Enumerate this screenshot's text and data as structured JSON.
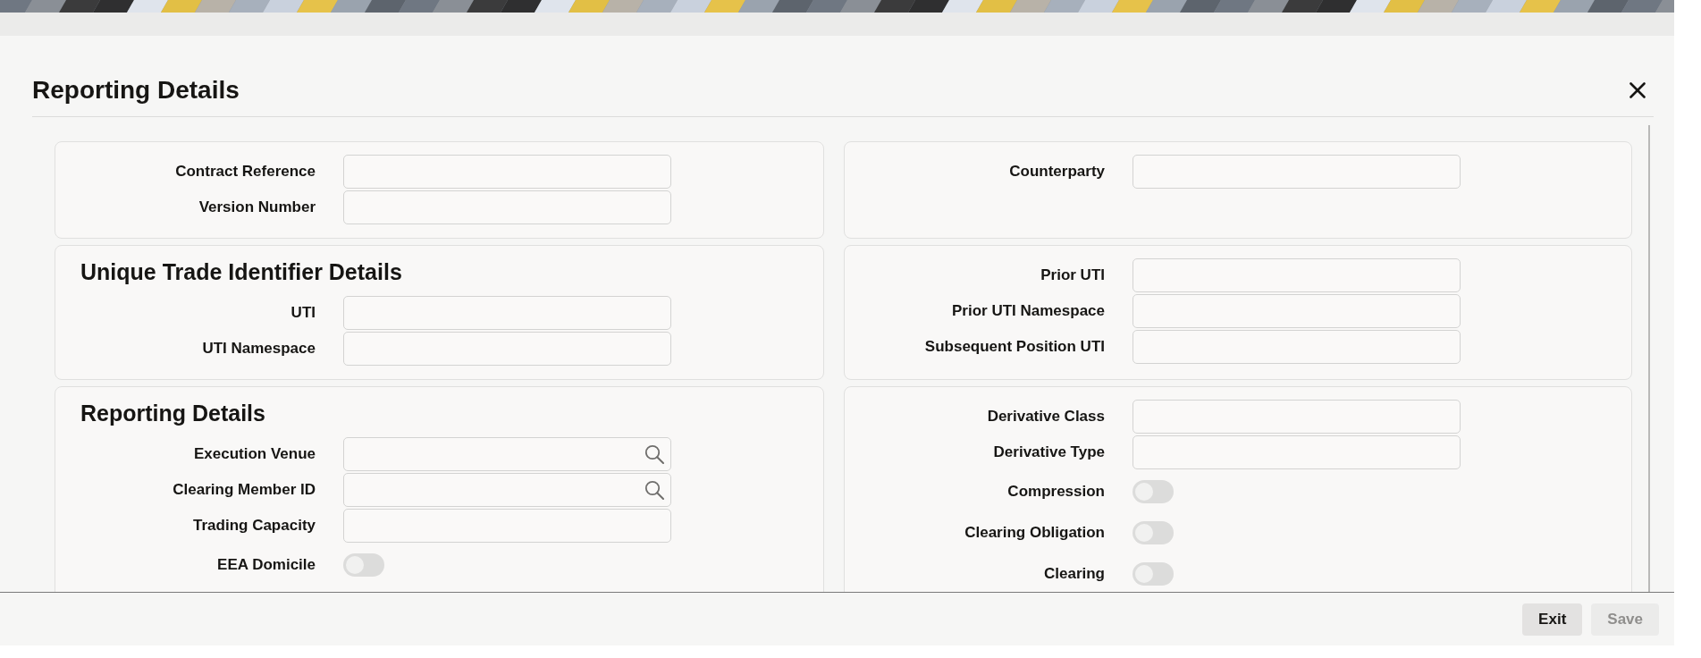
{
  "title": "Reporting Details",
  "rows": [
    {
      "left": {
        "fields": [
          {
            "kind": "text",
            "label": "Contract Reference"
          },
          {
            "kind": "text",
            "label": "Version Number"
          }
        ]
      },
      "right": {
        "fields": [
          {
            "kind": "text",
            "label": "Counterparty"
          }
        ]
      }
    },
    {
      "left": {
        "heading": "Unique Trade Identifier Details",
        "fields": [
          {
            "kind": "text",
            "label": "UTI"
          },
          {
            "kind": "text",
            "label": "UTI Namespace"
          }
        ]
      },
      "right": {
        "fields": [
          {
            "kind": "text",
            "label": "Prior UTI"
          },
          {
            "kind": "text",
            "label": "Prior UTI Namespace"
          },
          {
            "kind": "text",
            "label": "Subsequent Position UTI"
          }
        ]
      }
    },
    {
      "left": {
        "heading": "Reporting Details",
        "fields": [
          {
            "kind": "lookup",
            "label": "Execution Venue"
          },
          {
            "kind": "lookup",
            "label": "Clearing Member ID"
          },
          {
            "kind": "text",
            "label": "Trading Capacity"
          },
          {
            "kind": "toggle",
            "label": "EEA Domicile",
            "on": false
          }
        ]
      },
      "right": {
        "fields": [
          {
            "kind": "text",
            "label": "Derivative Class"
          },
          {
            "kind": "text",
            "label": "Derivative Type"
          },
          {
            "kind": "toggle",
            "label": "Compression",
            "on": false
          },
          {
            "kind": "toggle",
            "label": "Clearing Obligation",
            "on": false
          },
          {
            "kind": "toggle",
            "label": "Clearing",
            "on": false
          }
        ]
      }
    }
  ],
  "buttons": [
    {
      "label": "Exit",
      "disabled": false
    },
    {
      "label": "Save",
      "disabled": true
    }
  ]
}
